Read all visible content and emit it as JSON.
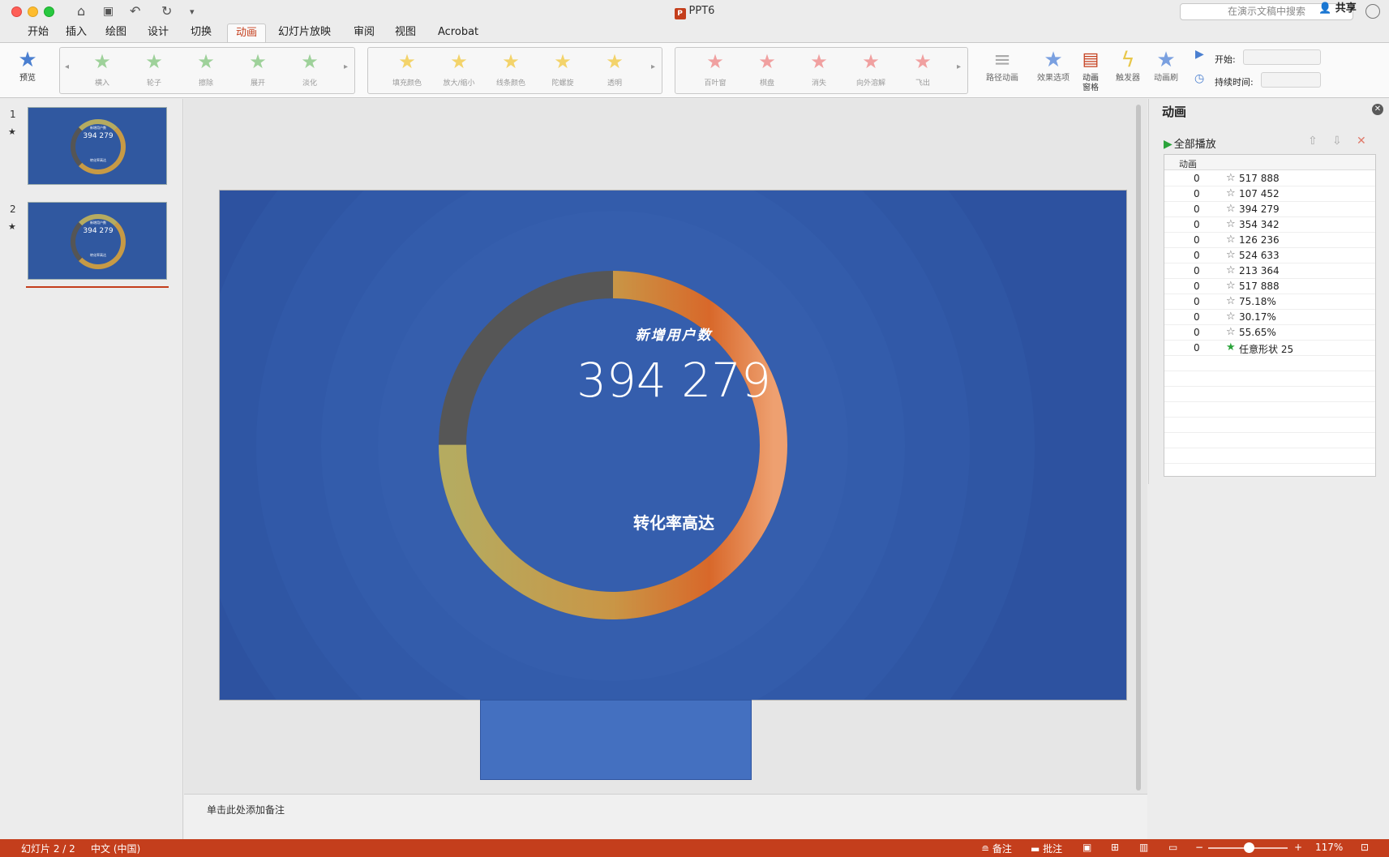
{
  "window": {
    "title": "PPT6",
    "search_placeholder": "在演示文稿中搜索"
  },
  "tabs": [
    {
      "label": "开始"
    },
    {
      "label": "插入"
    },
    {
      "label": "绘图"
    },
    {
      "label": "设计"
    },
    {
      "label": "切换"
    },
    {
      "label": "动画",
      "active": true
    },
    {
      "label": "幻灯片放映"
    },
    {
      "label": "审阅"
    },
    {
      "label": "视图"
    },
    {
      "label": "Acrobat"
    }
  ],
  "share_label": "共享",
  "ribbon": {
    "preview_label": "预览",
    "entrance_effects": [
      "横入",
      "轮子",
      "擦除",
      "展开",
      "淡化"
    ],
    "emphasis_effects": [
      "填充颜色",
      "放大/缩小",
      "线条颜色",
      "陀螺旋",
      "透明"
    ],
    "exit_effects": [
      "百叶窗",
      "棋盘",
      "消失",
      "向外溶解",
      "飞出"
    ],
    "path_animation_label": "路径动画",
    "effect_options_label": "效果选项",
    "animation_pane_label_1": "动画",
    "animation_pane_label_2": "窗格",
    "trigger_label": "触发器",
    "painter_label": "动画刷",
    "start_label": "开始:",
    "duration_label": "持续时间:"
  },
  "slides": [
    {
      "number": "1",
      "star": "★",
      "title": "新增用户数",
      "value": "394 279",
      "sub": "转化率高达"
    },
    {
      "number": "2",
      "star": "★",
      "title": "新增用户数",
      "value": "394 279",
      "sub": "转化率高达"
    }
  ],
  "current_slide": {
    "title": "新增用户数",
    "value": "394 279",
    "subtitle": "转化率高达",
    "ring_progress": 0.75
  },
  "notes_placeholder": "单击此处添加备注",
  "animation_pane": {
    "title": "动画",
    "play_all": "全部播放",
    "column_header": "动画",
    "items": [
      {
        "order": "0",
        "name": "517 888"
      },
      {
        "order": "0",
        "name": "107 452"
      },
      {
        "order": "0",
        "name": "394 279"
      },
      {
        "order": "0",
        "name": "354 342"
      },
      {
        "order": "0",
        "name": "126 236"
      },
      {
        "order": "0",
        "name": "524 633"
      },
      {
        "order": "0",
        "name": "213 364"
      },
      {
        "order": "0",
        "name": "517 888"
      },
      {
        "order": "0",
        "name": "75.18%"
      },
      {
        "order": "0",
        "name": "30.17%"
      },
      {
        "order": "0",
        "name": "55.65%"
      },
      {
        "order": "0",
        "name": "任意形状 25",
        "entrance": true
      }
    ]
  },
  "statusbar": {
    "slide_info": "幻灯片 2 / 2",
    "language": "中文 (中国)",
    "notes": "备注",
    "comments": "批注",
    "zoom": "117%"
  },
  "colors": {
    "accent": "#c43e1c",
    "slide_bg": "#2f55a0",
    "ring_gold": "#b5ab60",
    "ring_orange": "#e07a36",
    "ring_gray": "#555555"
  }
}
